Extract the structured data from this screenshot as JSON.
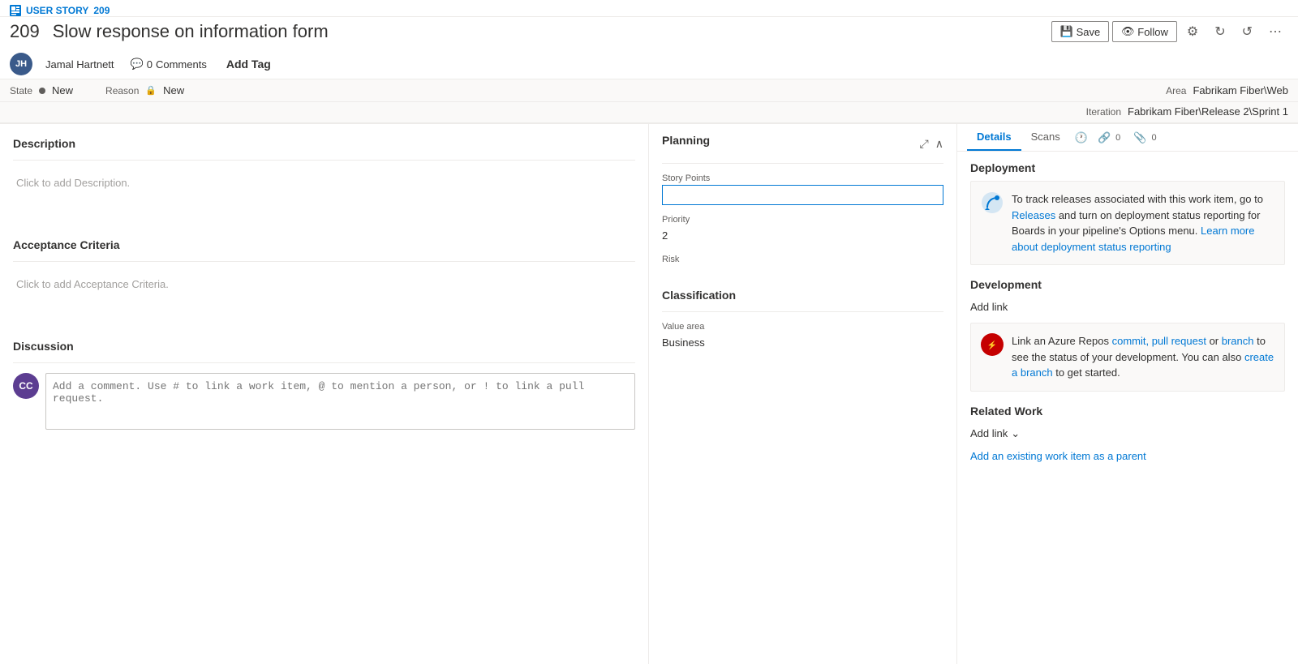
{
  "workItem": {
    "type": "USER STORY",
    "number": "209",
    "title": "Slow response on information form",
    "author": {
      "initials": "JH",
      "name": "Jamal Hartnett"
    },
    "commentsCount": "0",
    "commentsLabel": "Comments",
    "addTagLabel": "Add Tag",
    "state": {
      "label": "State",
      "value": "New"
    },
    "reason": {
      "label": "Reason",
      "value": "New"
    },
    "area": {
      "label": "Area",
      "value": "Fabrikam Fiber\\Web"
    },
    "iteration": {
      "label": "Iteration",
      "value": "Fabrikam Fiber\\Release 2\\Sprint 1"
    }
  },
  "toolbar": {
    "saveLabel": "Save",
    "followLabel": "Follow"
  },
  "tabs": {
    "details": "Details",
    "scans": "Scans",
    "historyIcon": "⏱",
    "linksLabel": "0",
    "attachmentsLabel": "0"
  },
  "description": {
    "sectionTitle": "Description",
    "placeholder": "Click to add Description."
  },
  "acceptanceCriteria": {
    "sectionTitle": "Acceptance Criteria",
    "placeholder": "Click to add Acceptance Criteria."
  },
  "discussion": {
    "sectionTitle": "Discussion",
    "avatarInitials": "CC",
    "inputPlaceholder": "Add a comment. Use # to link a work item, @ to mention a person, or ! to link a pull request."
  },
  "planning": {
    "sectionTitle": "Planning",
    "storyPointsLabel": "Story Points",
    "storyPointsValue": "",
    "priorityLabel": "Priority",
    "priorityValue": "2",
    "riskLabel": "Risk",
    "riskValue": ""
  },
  "classification": {
    "sectionTitle": "Classification",
    "valueAreaLabel": "Value area",
    "valueAreaValue": "Business"
  },
  "deployment": {
    "sectionTitle": "Deployment",
    "infoText": "To track releases associated with this work item, go to",
    "releasesLinkText": "Releases",
    "infoText2": "and turn on deployment status reporting for Boards in your pipeline's Options menu.",
    "learnMoreText": "Learn more about deployment status reporting",
    "learnMoreLink": "#"
  },
  "development": {
    "sectionTitle": "Development",
    "addLinkLabel": "Add link",
    "infoText": "Link an Azure Repos",
    "commitLinkText": "commit,",
    "pullRequestLinkText": "pull request",
    "infoText2": "or",
    "branchLinkText": "branch",
    "infoText3": "to see the status of your development. You can also",
    "createBranchText": "create a branch",
    "infoText4": "to get started."
  },
  "relatedWork": {
    "sectionTitle": "Related Work",
    "addLinkLabel": "Add link",
    "addExistingParentLabel": "Add an existing work item as a parent"
  }
}
